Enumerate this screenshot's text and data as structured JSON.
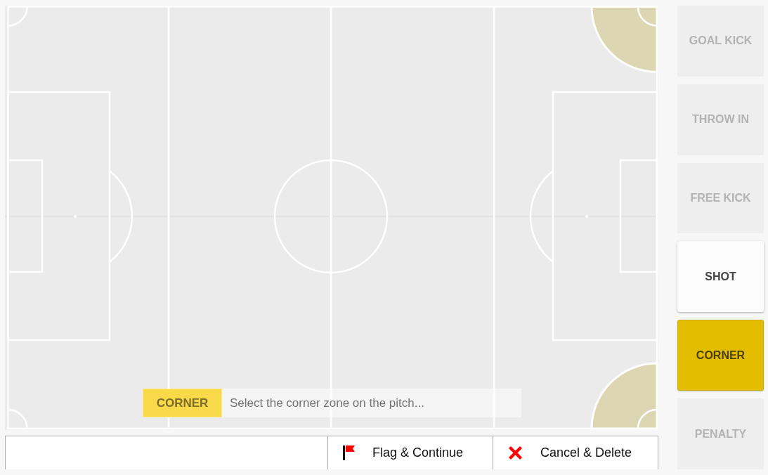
{
  "pitch": {
    "corner_zones": [
      {
        "highlighted": false
      },
      {
        "highlighted": true
      },
      {
        "highlighted": false
      },
      {
        "highlighted": true
      }
    ],
    "prompt": {
      "tag": "CORNER",
      "text": "Select the corner zone on the pitch..."
    }
  },
  "actions": [
    {
      "kind": "flag",
      "label": "Flag & Continue"
    },
    {
      "kind": "cancel",
      "label": "Cancel & Delete"
    }
  ],
  "event_types": [
    {
      "label": "GOAL KICK",
      "selected": false,
      "disabled": true
    },
    {
      "label": "THROW IN",
      "selected": false,
      "disabled": true
    },
    {
      "label": "FREE KICK",
      "selected": false,
      "disabled": true
    },
    {
      "label": "SHOT",
      "selected": false,
      "disabled": false
    },
    {
      "label": "CORNER",
      "selected": true,
      "disabled": false
    },
    {
      "label": "PENALTY",
      "selected": false,
      "disabled": true
    }
  ]
}
